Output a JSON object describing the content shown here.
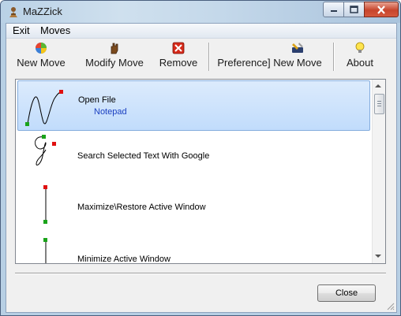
{
  "window": {
    "title": "MaZZick"
  },
  "menu": {
    "items": [
      "Exit",
      "Moves"
    ]
  },
  "toolbar": {
    "new_move": "New Move",
    "modify_move": "Modify Move",
    "remove": "Remove",
    "preferences": "Preference]",
    "new_move_2": "New Move",
    "about": "About"
  },
  "list": {
    "items": [
      {
        "title": "Open File",
        "subtitle": "Notepad",
        "selected": true
      },
      {
        "title": "Search Selected Text With Google",
        "subtitle": "",
        "selected": false
      },
      {
        "title": "Maximize\\Restore Active Window",
        "subtitle": "",
        "selected": false
      },
      {
        "title": "Minimize Active Window",
        "subtitle": "",
        "selected": false
      }
    ]
  },
  "footer": {
    "close_label": "Close"
  },
  "colors": {
    "gesture_start": "#1aa31a",
    "gesture_end": "#e01010",
    "selection": "#c1dcfc",
    "subtitle": "#1a3fc0"
  }
}
